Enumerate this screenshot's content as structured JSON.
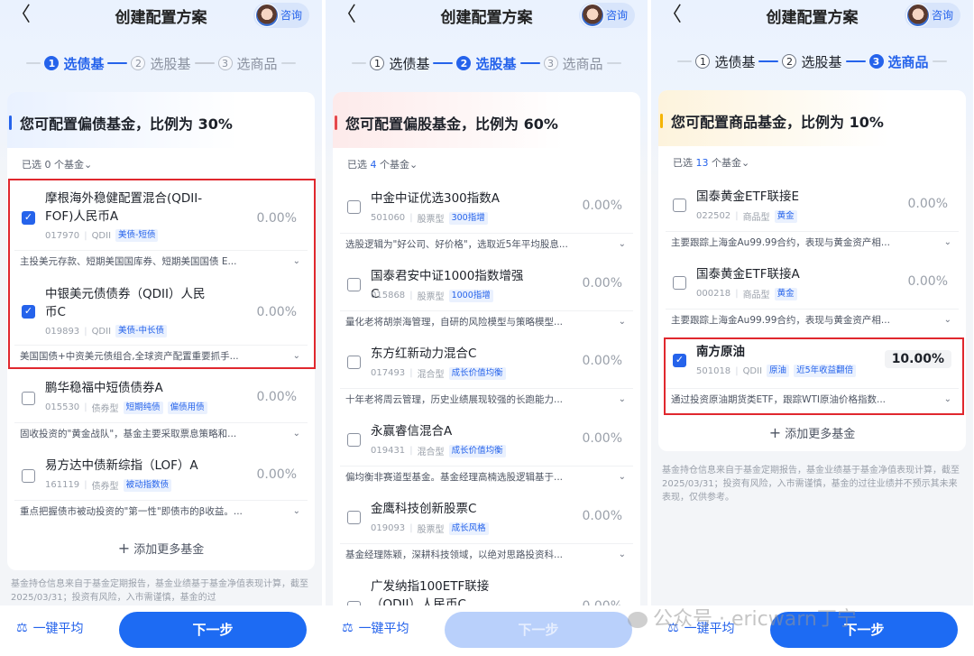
{
  "header": {
    "back_icon": "chevron-left-icon",
    "title": "创建配置方案",
    "consult_label": "咨询"
  },
  "steps": [
    {
      "num": "1",
      "label": "选债基"
    },
    {
      "num": "2",
      "label": "选股基"
    },
    {
      "num": "3",
      "label": "选商品"
    }
  ],
  "colors": {
    "accent": "#2563eb",
    "highlight_box": "#e0282e",
    "bond_bar": "#2563eb",
    "stock_bar": "#e5484d",
    "commodity_bar": "#f5b400"
  },
  "panels": [
    {
      "heading": "您可配置偏债基金，比例为 30%",
      "selected_prefix": "已选",
      "selected_count": "0",
      "selected_suffix": "个基金",
      "funds": [
        {
          "name": "摩根海外稳健配置混合(QDII-FOF)人民币A",
          "code": "017970",
          "type": "QDII",
          "tags": [
            "美债-短债"
          ],
          "pct": "0.00%",
          "checked": true,
          "desc": "主投美元存款、短期美国国库券、短期美国国债 E..."
        },
        {
          "name": "中银美元债债券（QDII）人民币C",
          "code": "019893",
          "type": "QDII",
          "tags": [
            "美债-中长债"
          ],
          "pct": "0.00%",
          "checked": true,
          "desc": "美国国债+中资美元债组合,全球资产配置重要抓手..."
        },
        {
          "name": "鹏华稳福中短债债券A",
          "code": "015530",
          "type": "债券型",
          "tags": [
            "短期纯债",
            "偏债用债"
          ],
          "pct": "0.00%",
          "checked": false,
          "desc": "固收投资的\"黄金战队\"，基金主要采取票息策略和..."
        },
        {
          "name": "易方达中债新综指（LOF）A",
          "code": "161119",
          "type": "债券型",
          "tags": [
            "被动指数债"
          ],
          "pct": "0.00%",
          "checked": false,
          "desc": "重点把握债市被动投资的\"第一性\"即债市的β收益。..."
        }
      ],
      "add_more": "添加更多基金",
      "disclaimer": "基金持仓信息来自于基金定期报告，基金业绩基于基金净值表现计算，截至2025/03/31；投资有风险，入市需谨慎，基金的过",
      "one_key_avg": "一键平均",
      "next": "下一步"
    },
    {
      "heading": "您可配置偏股基金，比例为 60%",
      "selected_prefix": "已选",
      "selected_count": "4",
      "selected_suffix": "个基金",
      "funds": [
        {
          "name": "中金中证优选300指数A",
          "code": "501060",
          "type": "股票型",
          "tags": [
            "300指增"
          ],
          "pct": "0.00%",
          "checked": false,
          "desc": "选股逻辑为\"好公司、好价格\"，选取近5年平均股息..."
        },
        {
          "name": "国泰君安中证1000指数增强C",
          "code": "015868",
          "type": "股票型",
          "tags": [
            "1000指增"
          ],
          "pct": "0.00%",
          "checked": false,
          "desc": "量化老将胡崇海管理，自研的风险模型与策略模型..."
        },
        {
          "name": "东方红新动力混合C",
          "code": "017493",
          "type": "混合型",
          "tags": [
            "成长价值均衡"
          ],
          "pct": "0.00%",
          "checked": false,
          "desc": "十年老将周云管理，历史业绩展现较强的长跑能力..."
        },
        {
          "name": "永赢睿信混合A",
          "code": "019431",
          "type": "混合型",
          "tags": [
            "成长价值均衡"
          ],
          "pct": "0.00%",
          "checked": false,
          "desc": "偏均衡非赛道型基金。基金经理高楠选股逻辑基于..."
        },
        {
          "name": "金鹰科技创新股票C",
          "code": "019093",
          "type": "股票型",
          "tags": [
            "成长风格"
          ],
          "pct": "0.00%",
          "checked": false,
          "desc": "基金经理陈颖，深耕科技领域，以绝对思路投资科..."
        },
        {
          "name": "广发纳指100ETF联接（QDII）人民币C",
          "code": "",
          "type": "",
          "tags": [],
          "pct": "0.00%",
          "checked": false,
          "desc": ""
        }
      ],
      "one_key_avg": "一键平均",
      "next": "下一步"
    },
    {
      "heading": "您可配置商品基金，比例为 10%",
      "selected_prefix": "已选",
      "selected_count": "13",
      "selected_suffix": "个基金",
      "funds": [
        {
          "name": "国泰黄金ETF联接E",
          "code": "022502",
          "type": "商品型",
          "tags": [
            "黄金"
          ],
          "pct": "0.00%",
          "checked": false,
          "desc": "主要跟踪上海金Au99.99合约，表现与黄金资产相..."
        },
        {
          "name": "国泰黄金ETF联接A",
          "code": "000218",
          "type": "商品型",
          "tags": [
            "黄金"
          ],
          "pct": "0.00%",
          "checked": false,
          "desc": "主要跟踪上海金Au99.99合约，表现与黄金资产相..."
        },
        {
          "name": "南方原油",
          "code": "501018",
          "type": "QDII",
          "tags": [
            "原油",
            "近5年收益翻倍"
          ],
          "pct": "10.00%",
          "checked": true,
          "desc": "通过投资原油期货类ETF，跟踪WTI原油价格指数..."
        }
      ],
      "add_more": "添加更多基金",
      "disclaimer": "基金持仓信息来自于基金定期报告，基金业绩基于基金净值表现计算，截至2025/03/31；投资有风险，入市需谨慎，基金的过往业绩并不预示其未来表现，仅供参考。",
      "one_key_avg": "一键平均",
      "next": "下一步"
    }
  ],
  "watermark": "公众号 · ericwarn丁宁"
}
